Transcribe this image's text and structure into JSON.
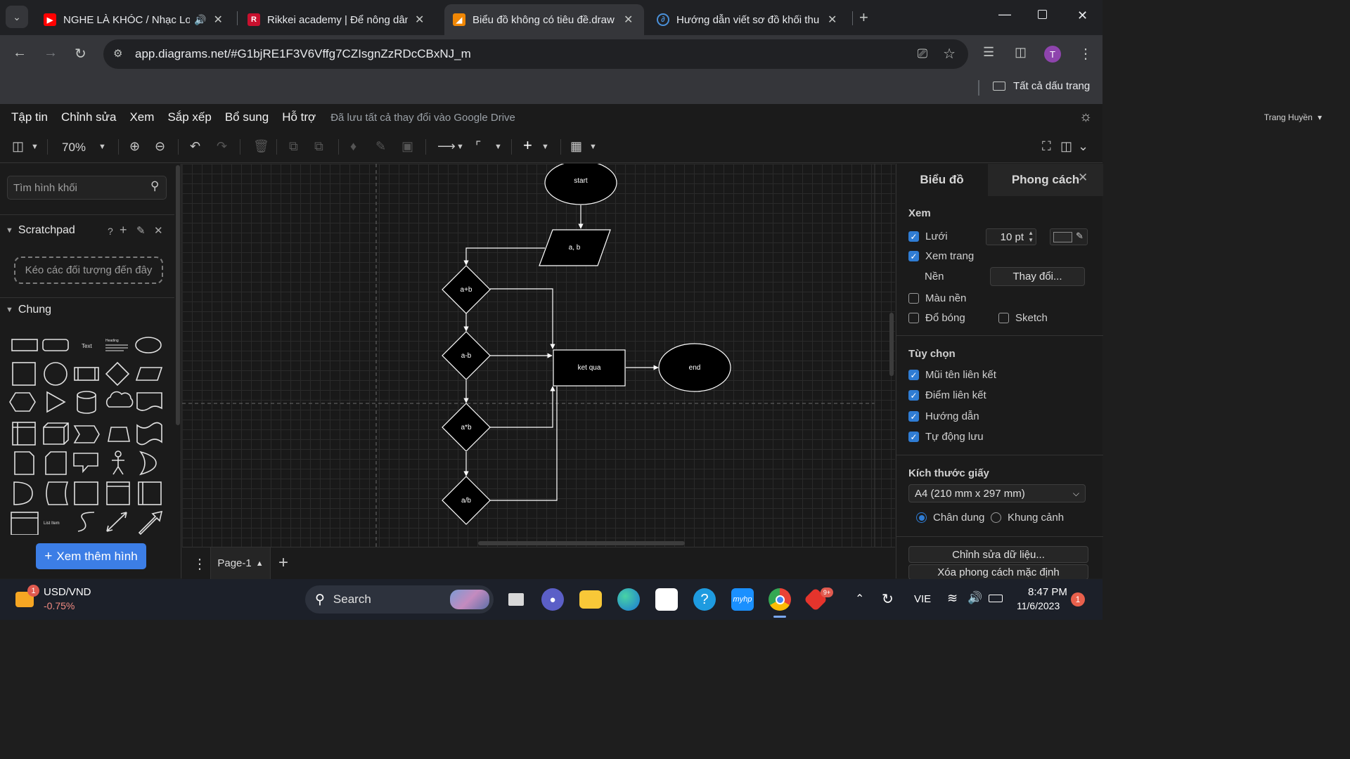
{
  "browser": {
    "tabs": [
      {
        "title": "NGHE LÀ KHÓC / Nhạc Lofi",
        "active": false
      },
      {
        "title": "Rikkei academy | Để nông dân",
        "active": false
      },
      {
        "title": "Biểu đồ không có tiêu đề.draw",
        "active": true
      },
      {
        "title": "Hướng dẫn viết sơ đồ khối thu",
        "active": false
      }
    ],
    "url": "app.diagrams.net/#G1bjRE1F3V6Vffg7CZIsgnZzRDcCBxNJ_m",
    "bookmarks_label": "Tất cả dấu trang",
    "profile_initial": "T"
  },
  "menu": {
    "items": [
      "Tập tin",
      "Chỉnh sửa",
      "Xem",
      "Sắp xếp",
      "Bổ sung",
      "Hỗ trợ"
    ],
    "saved_status": "Đã lưu tất cả thay đổi vào Google Drive",
    "user_name": "Trang Huyền"
  },
  "toolbar": {
    "zoom": "70%"
  },
  "left_panel": {
    "search_placeholder": "Tìm hình khối",
    "scratchpad_title": "Scratchpad",
    "scratchpad_help": "?",
    "scratchpad_drop": "Kéo các đối tượng đến đây",
    "general_title": "Chung",
    "shape_text_label": "Text",
    "shape_heading_label": "Heading",
    "shape_list_item_label": "List Item",
    "more_shapes": "Xem thêm hình"
  },
  "diagram": {
    "nodes": {
      "start": "start",
      "input": "a, b",
      "sum": "a+b",
      "diff": "a-b",
      "prod": "a*b",
      "div": "a/b",
      "result": "ket qua",
      "end": "end"
    }
  },
  "page_tabs": {
    "current": "Page-1"
  },
  "right_panel": {
    "tab_diagram": "Biểu đồ",
    "tab_style": "Phong cách",
    "view_section": "Xem",
    "grid_label": "Lưới",
    "grid_size": "10 pt",
    "page_view_label": "Xem trang",
    "background_label": "Nền",
    "change_button": "Thay đổi...",
    "bg_color_label": "Màu nền",
    "shadow_label": "Đổ bóng",
    "sketch_label": "Sketch",
    "options_section": "Tùy chọn",
    "connection_arrows": "Mũi tên liên kết",
    "connection_points": "Điểm liên kết",
    "guides": "Hướng dẫn",
    "autosave": "Tự động lưu",
    "paper_size_section": "Kích thước giấy",
    "paper_size": "A4 (210 mm x 297 mm)",
    "portrait": "Chân dung",
    "landscape": "Khung cảnh",
    "edit_data_button": "Chỉnh sửa dữ liệu...",
    "clear_style_button": "Xóa phong cách mặc định",
    "checkboxes": {
      "grid": true,
      "page_view": true,
      "bg_color": false,
      "shadow": false,
      "sketch": false,
      "connection_arrows": true,
      "connection_points": true,
      "guides": true,
      "autosave": true
    }
  },
  "taskbar": {
    "stock_name": "USD/VND",
    "stock_change": "-0.75%",
    "stock_badge": "1",
    "search_label": "Search",
    "language": "VIE",
    "time": "8:47 PM",
    "date": "11/6/2023",
    "notif_count": "1",
    "app_badge": "9+"
  }
}
